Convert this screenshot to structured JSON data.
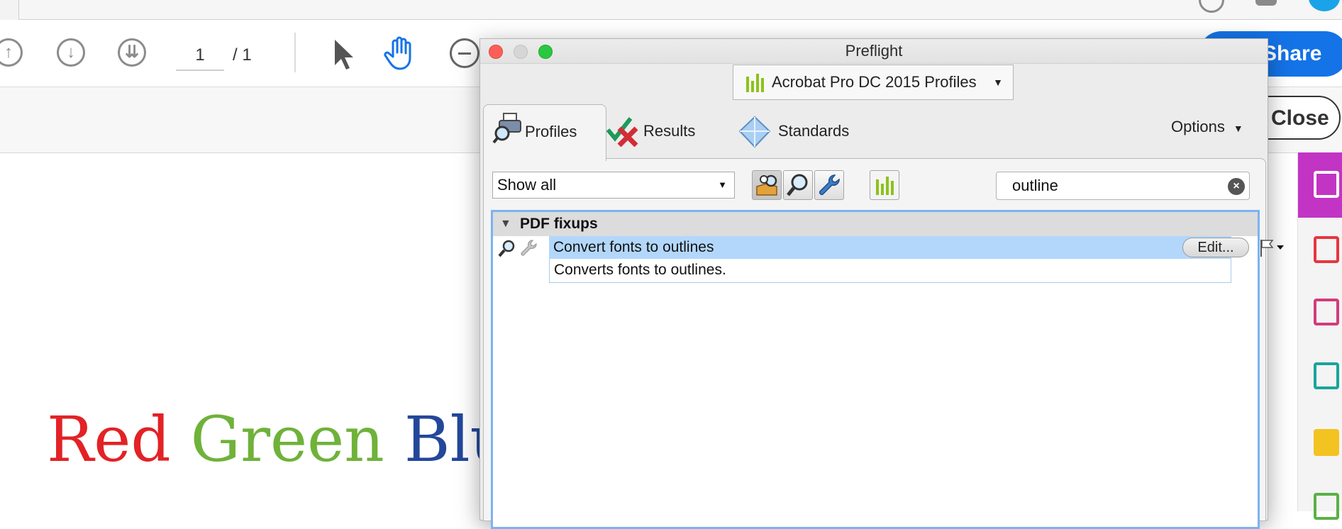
{
  "app": {
    "page_current": "1",
    "page_total": "/ 1",
    "share_label": "Share",
    "close_label": "Close",
    "document_words": [
      {
        "text": "Red",
        "color": "#e22226"
      },
      {
        "text": "Green",
        "color": "#6fb23a"
      },
      {
        "text": "Blue",
        "color": "#23479a"
      }
    ]
  },
  "dialog": {
    "title": "Preflight",
    "profiles_dropdown": "Acrobat Pro DC 2015 Profiles",
    "tabs": [
      {
        "label": "Profiles",
        "active": true
      },
      {
        "label": "Results",
        "active": false
      },
      {
        "label": "Standards",
        "active": false
      }
    ],
    "options_label": "Options",
    "filter_value": "Show all",
    "search_value": "outline",
    "group": {
      "label": "PDF fixups",
      "items": [
        {
          "label": "Convert fonts to outlines",
          "description": "Converts fonts to outlines.",
          "edit_label": "Edit..."
        }
      ]
    }
  },
  "colors": {
    "accent_blue": "#1473e6",
    "selection": "#b3d7fb",
    "rail_active": "#c234c4",
    "profile_green": "#8cc21c"
  }
}
